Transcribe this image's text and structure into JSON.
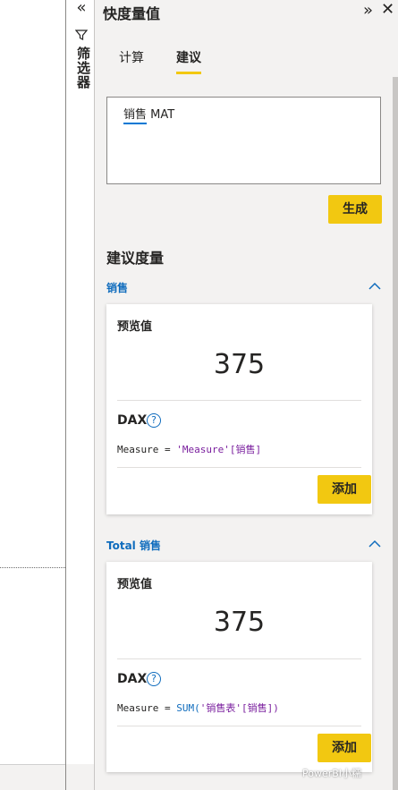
{
  "filter_pane": {
    "expand_glyph": "«",
    "label": "筛选器"
  },
  "quick_measure": {
    "title": "快度量值",
    "collapse_glyph": "»",
    "close_glyph": "✕",
    "tabs": [
      {
        "label": "计算",
        "selected": false
      },
      {
        "label": "建议",
        "selected": true
      }
    ],
    "query_prefix": "销售",
    "query_suffix": " MAT",
    "generate_label": "生成",
    "section_title": "建议度量",
    "groups": [
      {
        "header": "销售",
        "preview_label": "预览值",
        "preview_value": "375",
        "dax_label": "DAX",
        "help_glyph": "?",
        "dax_prefix": "Measure = ",
        "dax_fn": "",
        "dax_body": "'Measure'[销售]",
        "add_label": "添加"
      },
      {
        "header": "Total 销售",
        "preview_label": "预览值",
        "preview_value": "375",
        "dax_label": "DAX",
        "help_glyph": "?",
        "dax_prefix": "Measure = ",
        "dax_fn": "SUM(",
        "dax_body": "'销售表'[销售])",
        "add_label": "添加"
      }
    ]
  },
  "watermark": "PowerBI小糯",
  "colors": {
    "accent_yellow": "#f2c811",
    "link_blue": "#0f6cbd",
    "pane_bg": "#f3f2f1"
  }
}
